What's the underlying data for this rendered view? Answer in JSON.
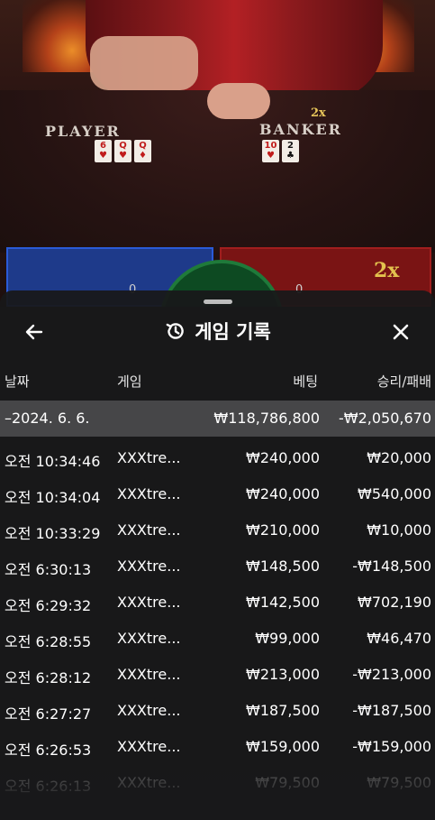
{
  "scene": {
    "player_label": "PLAYER",
    "banker_label": "BANKER",
    "top_multiplier": "2x",
    "banker_multiplier": "2x",
    "player_count": "0",
    "banker_count": "0",
    "player_cards": [
      "6 ♥",
      "Q ♥",
      "Q ♦"
    ],
    "banker_cards": [
      "10 ♥",
      "2 ♣"
    ],
    "colors": {
      "player_zone": "#1e3a8a",
      "banker_zone": "#7a1414",
      "tie_zone": "#0d4a22"
    }
  },
  "sheet": {
    "title": "게임 기록",
    "icons": {
      "back": "arrow-left-icon",
      "history": "history-icon",
      "close": "close-icon"
    },
    "columns": {
      "date": "날짜",
      "game": "게임",
      "bet": "베팅",
      "winloss": "승리/패배"
    },
    "summary": {
      "date": "–2024. 6. 6.",
      "bet": "₩118,786,800",
      "winloss": "-₩2,050,670"
    },
    "rows": [
      {
        "time": "오전 10:34:46",
        "game": "XXXtre...",
        "bet": "₩240,000",
        "winloss": "₩20,000"
      },
      {
        "time": "오전 10:34:04",
        "game": "XXXtre...",
        "bet": "₩240,000",
        "winloss": "₩540,000"
      },
      {
        "time": "오전 10:33:29",
        "game": "XXXtre...",
        "bet": "₩210,000",
        "winloss": "₩10,000"
      },
      {
        "time": "오전 6:30:13",
        "game": "XXXtre...",
        "bet": "₩148,500",
        "winloss": "-₩148,500"
      },
      {
        "time": "오전 6:29:32",
        "game": "XXXtre...",
        "bet": "₩142,500",
        "winloss": "₩702,190"
      },
      {
        "time": "오전 6:28:55",
        "game": "XXXtre...",
        "bet": "₩99,000",
        "winloss": "₩46,470"
      },
      {
        "time": "오전 6:28:12",
        "game": "XXXtre...",
        "bet": "₩213,000",
        "winloss": "-₩213,000"
      },
      {
        "time": "오전 6:27:27",
        "game": "XXXtre...",
        "bet": "₩187,500",
        "winloss": "-₩187,500"
      },
      {
        "time": "오전 6:26:53",
        "game": "XXXtre...",
        "bet": "₩159,000",
        "winloss": "-₩159,000"
      },
      {
        "time": "오전 6:26:13",
        "game": "XXXtre...",
        "bet": "₩79,500",
        "winloss": "₩79,500"
      }
    ]
  }
}
